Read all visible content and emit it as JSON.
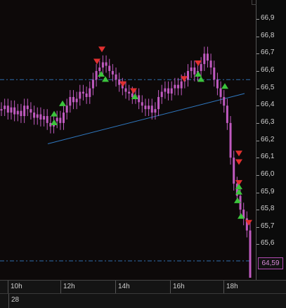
{
  "colors": {
    "background": "#0d0909",
    "candle": "#c05ac0",
    "sell_marker": "#e03030",
    "buy_marker": "#3cc43c",
    "reference_line": "#2f6fae",
    "trendline": "#2f78c0",
    "axis_text": "#cfcfcf",
    "last_price_border": "#b04bb0"
  },
  "price_axis": {
    "labels": [
      "66,9",
      "66,8",
      "66,7",
      "66,6",
      "66,5",
      "66,4",
      "66,3",
      "66,2",
      "66,1",
      "66,0",
      "65,9",
      "65,8",
      "65,7",
      "65,6"
    ],
    "last_price": "64,59"
  },
  "time_axis": {
    "labels": [
      "10h",
      "12h",
      "14h",
      "16h",
      "18h"
    ]
  },
  "date_axis": {
    "label": "28"
  },
  "chart_data": {
    "type": "line",
    "title": "",
    "xlabel": "",
    "ylabel": "",
    "ylim": [
      65.5,
      66.95
    ],
    "x_ticks": [
      "10h",
      "12h",
      "14h",
      "16h",
      "18h"
    ],
    "y_ticks": [
      66.9,
      66.8,
      66.7,
      66.6,
      66.5,
      66.4,
      66.3,
      66.2,
      66.1,
      66.0,
      65.9,
      65.8,
      65.7,
      65.6
    ],
    "series": [
      {
        "values": [
          66.38,
          66.4,
          66.36,
          66.39,
          66.35,
          66.37,
          66.34,
          66.4,
          66.38,
          66.36,
          66.33,
          66.35,
          66.32,
          66.34,
          66.3,
          66.28,
          66.31,
          66.33,
          66.3,
          66.36,
          66.4,
          66.45,
          66.42,
          66.44,
          66.48,
          66.47,
          66.45,
          66.5,
          66.55,
          66.6,
          66.62,
          66.65,
          66.63,
          66.6,
          66.58,
          66.55,
          66.52,
          66.5,
          66.48,
          66.47,
          66.45,
          66.46,
          66.42,
          66.4,
          66.38,
          66.4,
          66.36,
          66.38,
          66.45,
          66.48,
          66.5,
          66.47,
          66.5,
          66.52,
          66.5,
          66.54,
          66.55,
          66.6,
          66.62,
          66.58,
          66.6,
          66.64,
          66.7,
          66.66,
          66.62,
          66.55,
          66.5,
          66.45,
          66.4,
          66.3,
          66.1,
          65.95,
          65.88,
          65.8,
          65.75,
          65.68,
          64.59
        ]
      }
    ],
    "reference_lines": [
      66.55,
      64.59
    ],
    "trendline": {
      "start": 66.18,
      "end": 66.47
    },
    "sell_signals": [
      66.7,
      66.63,
      66.5,
      66.46,
      66.53,
      66.62,
      66.1,
      66.05,
      65.93,
      65.7
    ],
    "buy_signals": [
      66.32,
      66.37,
      66.43,
      66.6,
      66.57,
      66.47,
      66.6,
      66.53,
      66.57,
      65.95,
      65.92,
      65.87,
      65.78
    ]
  }
}
